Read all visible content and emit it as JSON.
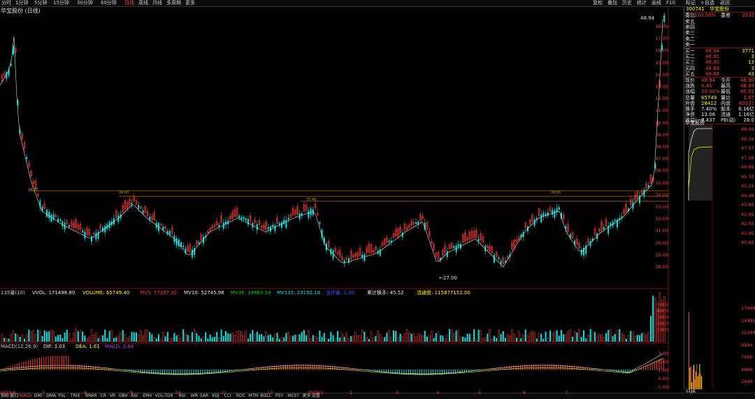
{
  "toolbar": {
    "periods": [
      "分时",
      "1分钟",
      "5分钟",
      "15分钟",
      "30分钟",
      "60分钟",
      "日线",
      "周线",
      "月线",
      "多周期",
      "更多"
    ],
    "active_period": "日线",
    "right_items": [
      "复权",
      "叠加",
      "历史",
      "统计",
      "画线",
      "F10",
      "标记",
      "+自选",
      "返回"
    ]
  },
  "chart": {
    "title": "华宝股份 (日线)",
    "price_axis": [
      "18.00",
      "17.00",
      "16.00",
      "15.00",
      "14.00",
      "13.00",
      "12.00",
      "11.00",
      "10.00",
      "39.00",
      "38.00",
      "37.00",
      "36.00",
      "35.00",
      "34.00",
      "33.00",
      "32.00",
      "31.00",
      "30.00",
      "29.00",
      "28.00"
    ],
    "annotations": {
      "high_label": "48.94",
      "low_label": "27.00",
      "left_mark": "34.37",
      "mark2": "34.00",
      "mark3": "33.40",
      "mark4": "34.05"
    },
    "volume_legend": {
      "ma_label": "135量(10)",
      "vvol": "VVOL: 171498.80",
      "volume": "VOLUME: 65749.40",
      "mv5": "MV5: 77397.32",
      "mv10": "MV10: 52745.98",
      "mv35": "MV35: 34864.54",
      "mv135": "MV135: 23192.18",
      "rise": "涨停量: 1.00",
      "turnover": "累计换手: 45.52",
      "float": "流通盘: 115877152.00"
    },
    "volume_axis": [
      "5000",
      "4000",
      "3000",
      "2000",
      "1000"
    ],
    "macd_legend": {
      "label": "MACD(12,26,9)",
      "dif": "DIF: 3.03",
      "dea": "DEA: 1.61",
      "macd": "MACD: 2.84"
    },
    "macd_axis": [
      "3.00",
      "2.00",
      "1.00",
      "0.00",
      "-1.00"
    ],
    "dates": [
      "2019/6",
      "7",
      "8",
      "9",
      "10",
      "11",
      "12",
      "2020/1",
      "2",
      "3",
      "4",
      "5",
      "6",
      "7"
    ]
  },
  "panel": {
    "code": "300741",
    "name": "华宝股份",
    "weibi_label": "委比",
    "weibi_value": "100.00%",
    "weicha_label": "委差",
    "weicha_value": "3533",
    "sells": [
      {
        "label": "卖五",
        "price": "",
        "vol": ""
      },
      {
        "label": "卖四",
        "price": "",
        "vol": ""
      },
      {
        "label": "卖三",
        "price": "",
        "vol": ""
      },
      {
        "label": "卖二",
        "price": "",
        "vol": ""
      },
      {
        "label": "卖一",
        "price": "",
        "vol": ""
      }
    ],
    "buys": [
      {
        "label": "买一",
        "price": "48.94",
        "vol": "3771"
      },
      {
        "label": "买二",
        "price": "48.91",
        "vol": "3"
      },
      {
        "label": "买三",
        "price": "48.90",
        "vol": "13"
      },
      {
        "label": "买四",
        "price": "48.89",
        "vol": "3"
      },
      {
        "label": "买五",
        "price": "48.88",
        "vol": "43"
      }
    ],
    "stats": [
      {
        "l1": "现价",
        "v1": "48.94",
        "l2": "今开",
        "v2": "46.90"
      },
      {
        "l1": "涨跌",
        "v1": "4.45",
        "l2": "最高",
        "v2": "48.94"
      },
      {
        "l1": "涨幅",
        "v1": "10.00%",
        "l2": "最低",
        "v2": "45.02"
      },
      {
        "l1": "总量",
        "v1": "65749",
        "l2": "量比",
        "v2": "2.67"
      },
      {
        "l1": "外盘",
        "v1": "28412",
        "l2": "内盘",
        "v2": "40337"
      },
      {
        "l1": "换手",
        "v1": "7.40%",
        "l2": "股本",
        "v2": "6.16亿"
      },
      {
        "l1": "净资",
        "v1": "13.06",
        "l2": "流通",
        "v2": "1.16亿"
      },
      {
        "l1": "收益(一)",
        "v1": "0.437",
        "l2": "PE(动)",
        "v2": "28.0"
      }
    ],
    "mini_title": "华宝股份",
    "mini_axis": [
      "48.94",
      "48.18",
      "47.67",
      "47.18",
      "46.68",
      "45.70",
      "45.21",
      "44.48",
      "43.85",
      "42.95",
      "42.55",
      "41.95",
      "40.65"
    ],
    "mini_vol_axis": [
      "17499",
      "14992",
      "12494",
      "9994",
      "7496",
      "4999",
      "2499"
    ],
    "mini_bottom": "日线"
  },
  "bottom_bar": {
    "items": [
      "指标",
      "窗口",
      "MACD",
      "DMI",
      "DMA",
      "FSL",
      "TRIX",
      "BRAR",
      "CR",
      "VR",
      "OBV",
      "ASI",
      "EMV",
      "VOL-TDX",
      "RSI",
      "WR",
      "SAR",
      "KDJ",
      "CCI",
      "ROC",
      "MTM",
      "BOLL",
      "PSY",
      "MCST",
      "更多",
      "设置"
    ],
    "active": "MACD"
  },
  "colors": {
    "up": "#ff3b3b",
    "down": "#00e5e5",
    "ma": "#e0e0e0",
    "accent": "#ffff00"
  }
}
